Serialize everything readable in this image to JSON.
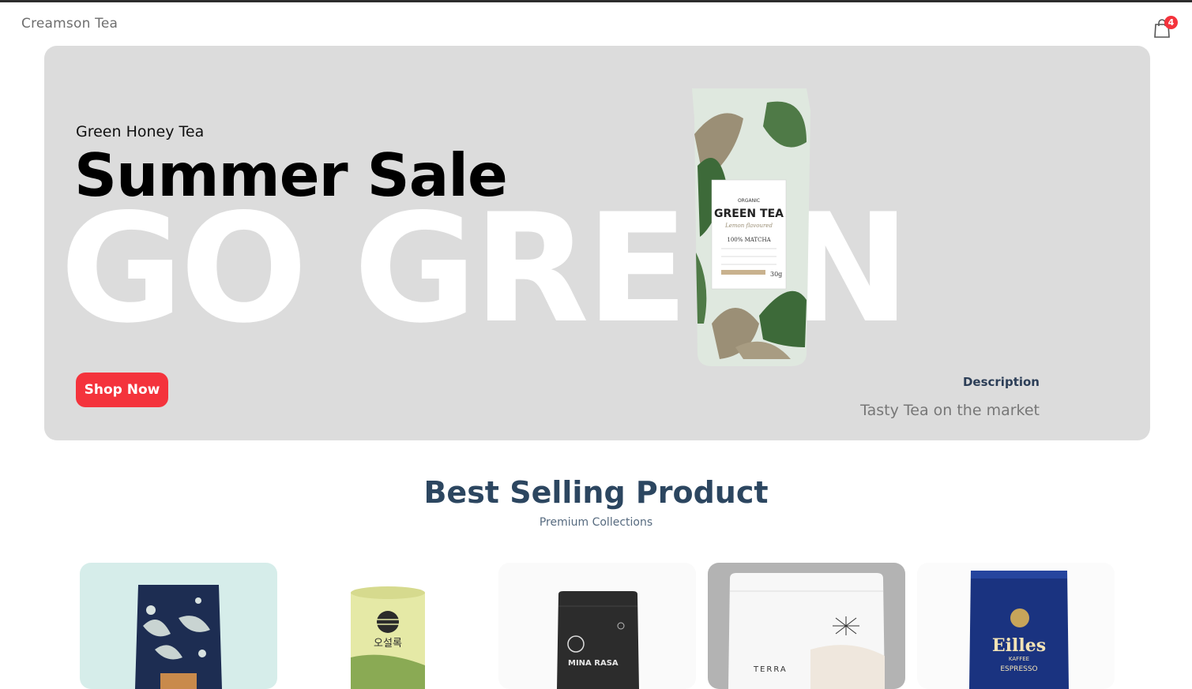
{
  "header": {
    "brand": "Creamson Tea",
    "cart_count": "4"
  },
  "hero": {
    "small_text": "Green Honey Tea",
    "mid_text": "Summer Sale",
    "large_text": "GO GREEN",
    "button_label": "Shop Now",
    "description_title": "Description",
    "description_text": "Tasty Tea on the market",
    "pouch_label": {
      "top": "ORGANIC",
      "main": "GREEN TEA",
      "script": "Lemon flavoured",
      "sub": "100% MATCHA",
      "weight": "30g"
    }
  },
  "section": {
    "title": "Best Selling Product",
    "subtitle": "Premium Collections"
  },
  "products": [
    {
      "name": "product-1",
      "bg": "#d6edea"
    },
    {
      "name": "product-2",
      "bg": "#ffffff",
      "label": "오설록"
    },
    {
      "name": "product-3",
      "bg": "#fafafa",
      "label": "MINA RASA"
    },
    {
      "name": "product-4",
      "bg": "#b3b3b3",
      "label": "TERRA"
    },
    {
      "name": "product-5",
      "bg": "#fbfbfb",
      "label": "Eilles",
      "sub1": "KAFFEE",
      "sub2": "ESPRESSO"
    }
  ],
  "colors": {
    "accent": "#f4333c",
    "heading": "#2c4660",
    "hero_bg": "#dcdcdc"
  }
}
